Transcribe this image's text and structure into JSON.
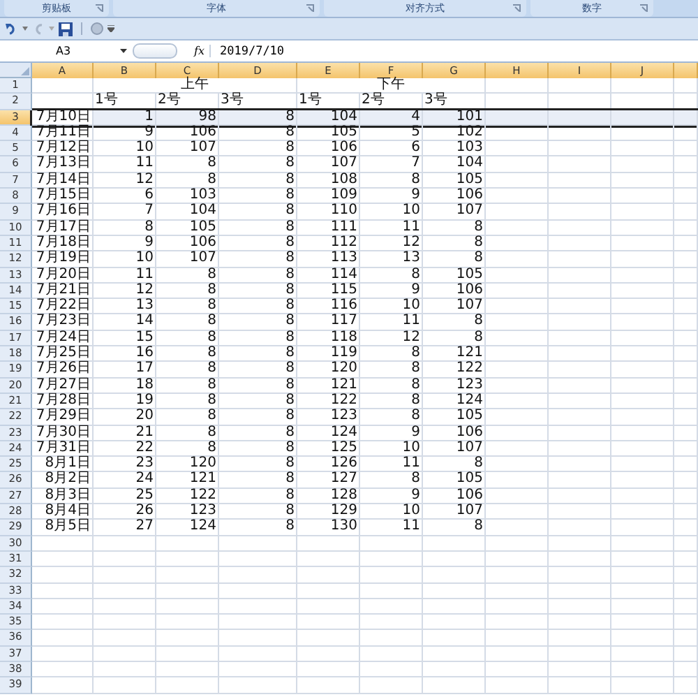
{
  "ribbon_groups": [
    "剪贴板",
    "字体",
    "对齐方式",
    "数字"
  ],
  "formula_bar": {
    "name_box": "A3",
    "function_symbol": "fx",
    "value": "2019/7/10"
  },
  "columns": [
    "A",
    "B",
    "C",
    "D",
    "E",
    "F",
    "G",
    "H",
    "I",
    "J"
  ],
  "rows": [
    {
      "number": "1",
      "kind": "group",
      "selected": false,
      "groups": [
        "上午",
        "下午"
      ]
    },
    {
      "number": "2",
      "kind": "label",
      "selected": false,
      "cells": [
        "1号",
        "2号",
        "3号",
        "1号",
        "2号",
        "3号"
      ]
    },
    {
      "number": "3",
      "kind": "data",
      "selected": true,
      "cells": [
        "7月10日",
        "1",
        "98",
        "8",
        "104",
        "4",
        "101"
      ]
    },
    {
      "number": "4",
      "kind": "data",
      "selected": false,
      "cells": [
        "7月11日",
        "9",
        "106",
        "8",
        "105",
        "5",
        "102"
      ]
    },
    {
      "number": "5",
      "kind": "data",
      "selected": false,
      "cells": [
        "7月12日",
        "10",
        "107",
        "8",
        "106",
        "6",
        "103"
      ]
    },
    {
      "number": "6",
      "kind": "data",
      "selected": false,
      "cells": [
        "7月13日",
        "11",
        "8",
        "8",
        "107",
        "7",
        "104"
      ]
    },
    {
      "number": "7",
      "kind": "data",
      "selected": false,
      "cells": [
        "7月14日",
        "12",
        "8",
        "8",
        "108",
        "8",
        "105"
      ]
    },
    {
      "number": "8",
      "kind": "data",
      "selected": false,
      "cells": [
        "7月15日",
        "6",
        "103",
        "8",
        "109",
        "9",
        "106"
      ]
    },
    {
      "number": "9",
      "kind": "data",
      "selected": false,
      "cells": [
        "7月16日",
        "7",
        "104",
        "8",
        "110",
        "10",
        "107"
      ]
    },
    {
      "number": "10",
      "kind": "data",
      "selected": false,
      "cells": [
        "7月17日",
        "8",
        "105",
        "8",
        "111",
        "11",
        "8"
      ]
    },
    {
      "number": "11",
      "kind": "data",
      "selected": false,
      "cells": [
        "7月18日",
        "9",
        "106",
        "8",
        "112",
        "12",
        "8"
      ]
    },
    {
      "number": "12",
      "kind": "data",
      "selected": false,
      "cells": [
        "7月19日",
        "10",
        "107",
        "8",
        "113",
        "13",
        "8"
      ]
    },
    {
      "number": "13",
      "kind": "data",
      "selected": false,
      "cells": [
        "7月20日",
        "11",
        "8",
        "8",
        "114",
        "8",
        "105"
      ]
    },
    {
      "number": "14",
      "kind": "data",
      "selected": false,
      "cells": [
        "7月21日",
        "12",
        "8",
        "8",
        "115",
        "9",
        "106"
      ]
    },
    {
      "number": "15",
      "kind": "data",
      "selected": false,
      "cells": [
        "7月22日",
        "13",
        "8",
        "8",
        "116",
        "10",
        "107"
      ]
    },
    {
      "number": "16",
      "kind": "data",
      "selected": false,
      "cells": [
        "7月23日",
        "14",
        "8",
        "8",
        "117",
        "11",
        "8"
      ]
    },
    {
      "number": "17",
      "kind": "data",
      "selected": false,
      "cells": [
        "7月24日",
        "15",
        "8",
        "8",
        "118",
        "12",
        "8"
      ]
    },
    {
      "number": "18",
      "kind": "data",
      "selected": false,
      "cells": [
        "7月25日",
        "16",
        "8",
        "8",
        "119",
        "8",
        "121"
      ]
    },
    {
      "number": "19",
      "kind": "data",
      "selected": false,
      "cells": [
        "7月26日",
        "17",
        "8",
        "8",
        "120",
        "8",
        "122"
      ]
    },
    {
      "number": "20",
      "kind": "data",
      "selected": false,
      "cells": [
        "7月27日",
        "18",
        "8",
        "8",
        "121",
        "8",
        "123"
      ]
    },
    {
      "number": "21",
      "kind": "data",
      "selected": false,
      "cells": [
        "7月28日",
        "19",
        "8",
        "8",
        "122",
        "8",
        "124"
      ]
    },
    {
      "number": "22",
      "kind": "data",
      "selected": false,
      "cells": [
        "7月29日",
        "20",
        "8",
        "8",
        "123",
        "8",
        "105"
      ]
    },
    {
      "number": "23",
      "kind": "data",
      "selected": false,
      "cells": [
        "7月30日",
        "21",
        "8",
        "8",
        "124",
        "9",
        "106"
      ]
    },
    {
      "number": "24",
      "kind": "data",
      "selected": false,
      "cells": [
        "7月31日",
        "22",
        "8",
        "8",
        "125",
        "10",
        "107"
      ]
    },
    {
      "number": "25",
      "kind": "data",
      "selected": false,
      "cells": [
        "8月1日",
        "23",
        "120",
        "8",
        "126",
        "11",
        "8"
      ]
    },
    {
      "number": "26",
      "kind": "data",
      "selected": false,
      "cells": [
        "8月2日",
        "24",
        "121",
        "8",
        "127",
        "8",
        "105"
      ]
    },
    {
      "number": "27",
      "kind": "data",
      "selected": false,
      "cells": [
        "8月3日",
        "25",
        "122",
        "8",
        "128",
        "9",
        "106"
      ]
    },
    {
      "number": "28",
      "kind": "data",
      "selected": false,
      "cells": [
        "8月4日",
        "26",
        "123",
        "8",
        "129",
        "10",
        "107"
      ]
    },
    {
      "number": "29",
      "kind": "data",
      "selected": false,
      "cells": [
        "8月5日",
        "27",
        "124",
        "8",
        "130",
        "11",
        "8"
      ]
    },
    {
      "number": "30",
      "kind": "empty",
      "selected": false
    },
    {
      "number": "31",
      "kind": "empty",
      "selected": false
    },
    {
      "number": "32",
      "kind": "empty",
      "selected": false
    },
    {
      "number": "33",
      "kind": "empty",
      "selected": false
    },
    {
      "number": "34",
      "kind": "empty",
      "selected": false
    },
    {
      "number": "35",
      "kind": "empty",
      "selected": false
    },
    {
      "number": "36",
      "kind": "empty",
      "selected": false
    },
    {
      "number": "37",
      "kind": "empty",
      "selected": false
    },
    {
      "number": "38",
      "kind": "empty",
      "selected": false
    },
    {
      "number": "39",
      "kind": "empty",
      "selected": false
    }
  ]
}
